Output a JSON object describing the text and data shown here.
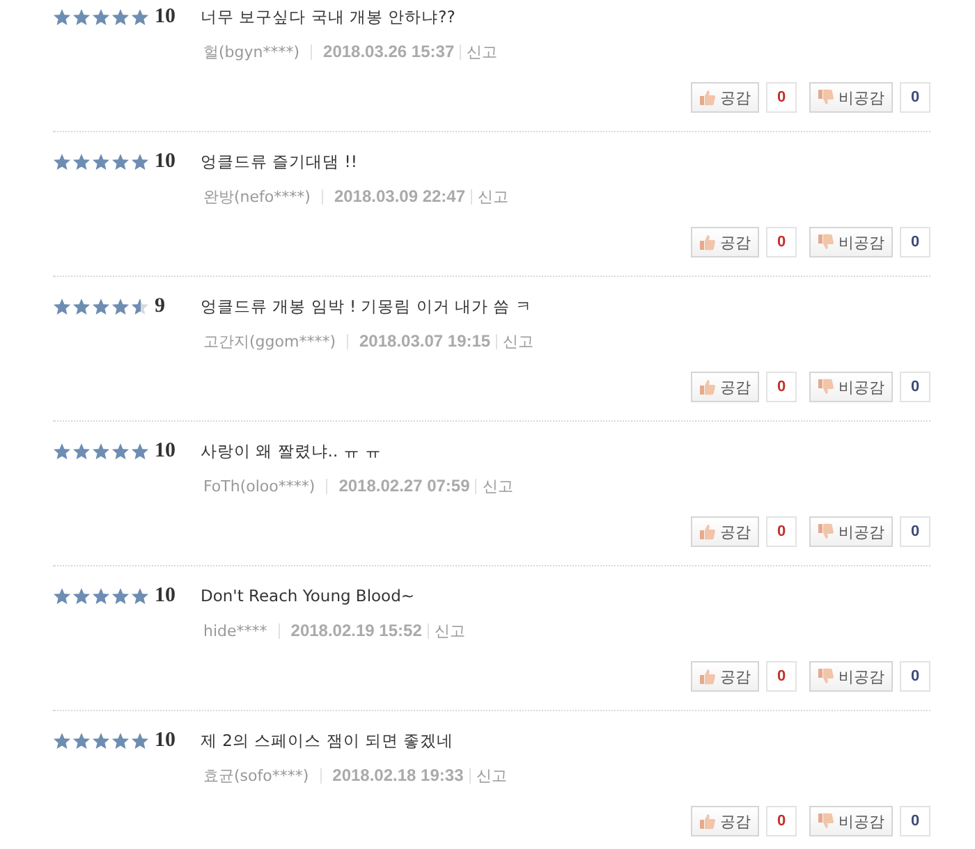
{
  "reviews": [
    {
      "stars": 5,
      "score": "10",
      "text": "너무 보구싶다 국내 개봉 안하냐??",
      "author": "헐(bgyn****)",
      "date": "2018.03.26 15:37",
      "report": "신고",
      "like_label": "공감",
      "like_count": "0",
      "dislike_label": "비공감",
      "dislike_count": "0"
    },
    {
      "stars": 5,
      "score": "10",
      "text": "엉클드류 즐기대댐 !!",
      "author": "완방(nefo****)",
      "date": "2018.03.09 22:47",
      "report": "신고",
      "like_label": "공감",
      "like_count": "0",
      "dislike_label": "비공감",
      "dislike_count": "0"
    },
    {
      "stars": 4.5,
      "score": "9",
      "text": "엉클드류 개봉 임박 ! 기몽림 이거 내가 씀 ㅋ",
      "author": "고간지(ggom****)",
      "date": "2018.03.07 19:15",
      "report": "신고",
      "like_label": "공감",
      "like_count": "0",
      "dislike_label": "비공감",
      "dislike_count": "0"
    },
    {
      "stars": 5,
      "score": "10",
      "text": "사랑이 왜 짤렸냐.. ㅠ ㅠ",
      "author": "FoTh(oloo****)",
      "date": "2018.02.27 07:59",
      "report": "신고",
      "like_label": "공감",
      "like_count": "0",
      "dislike_label": "비공감",
      "dislike_count": "0"
    },
    {
      "stars": 5,
      "score": "10",
      "text": "Don't Reach Young Blood~",
      "author": "hide****",
      "date": "2018.02.19 15:52",
      "report": "신고",
      "like_label": "공감",
      "like_count": "0",
      "dislike_label": "비공감",
      "dislike_count": "0"
    },
    {
      "stars": 5,
      "score": "10",
      "text": "제 2의 스페이스 잼이 되면 좋겠네",
      "author": "효균(sofo****)",
      "date": "2018.02.18 19:33",
      "report": "신고",
      "like_label": "공감",
      "like_count": "0",
      "dislike_label": "비공감",
      "dislike_count": "0"
    }
  ]
}
